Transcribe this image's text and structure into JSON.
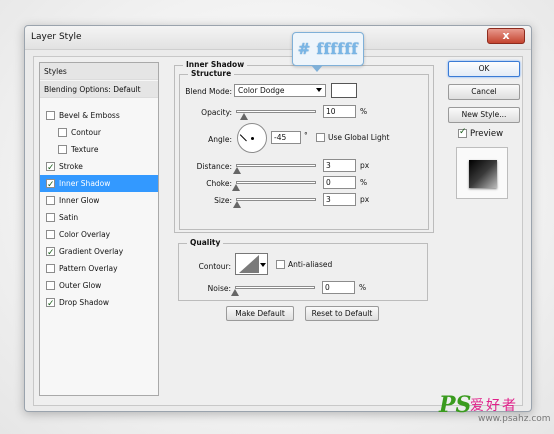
{
  "window": {
    "title": "Layer Style",
    "close_label": "x"
  },
  "styles_panel": {
    "header": "Styles",
    "blending_options": "Blending Options: Default",
    "items": [
      {
        "label": "Bevel & Emboss",
        "checked": false,
        "indent": false,
        "selected": false
      },
      {
        "label": "Contour",
        "checked": false,
        "indent": true,
        "selected": false
      },
      {
        "label": "Texture",
        "checked": false,
        "indent": true,
        "selected": false
      },
      {
        "label": "Stroke",
        "checked": true,
        "indent": false,
        "selected": false
      },
      {
        "label": "Inner Shadow",
        "checked": true,
        "indent": false,
        "selected": true
      },
      {
        "label": "Inner Glow",
        "checked": false,
        "indent": false,
        "selected": false
      },
      {
        "label": "Satin",
        "checked": false,
        "indent": false,
        "selected": false
      },
      {
        "label": "Color Overlay",
        "checked": false,
        "indent": false,
        "selected": false
      },
      {
        "label": "Gradient Overlay",
        "checked": true,
        "indent": false,
        "selected": false
      },
      {
        "label": "Pattern Overlay",
        "checked": false,
        "indent": false,
        "selected": false
      },
      {
        "label": "Outer Glow",
        "checked": false,
        "indent": false,
        "selected": false
      },
      {
        "label": "Drop Shadow",
        "checked": true,
        "indent": false,
        "selected": false
      }
    ]
  },
  "inner_shadow": {
    "section_title": "Inner Shadow",
    "structure_title": "Structure",
    "blend_mode_label": "Blend Mode:",
    "blend_mode_value": "Color Dodge",
    "color_swatch": "#ffffff",
    "opacity_label": "Opacity:",
    "opacity_value": "10",
    "opacity_unit": "%",
    "angle_label": "Angle:",
    "angle_value": "-45",
    "angle_unit": "°",
    "use_global_light_label": "Use Global Light",
    "use_global_light_checked": false,
    "distance_label": "Distance:",
    "distance_value": "3",
    "distance_unit": "px",
    "choke_label": "Choke:",
    "choke_value": "0",
    "choke_unit": "%",
    "size_label": "Size:",
    "size_value": "3",
    "size_unit": "px",
    "opacity_level": 0.1,
    "distance_level": 0.012,
    "choke_level": 0,
    "size_level": 0.012
  },
  "quality": {
    "title": "Quality",
    "contour_label": "Contour:",
    "anti_aliased_label": "Anti-aliased",
    "anti_aliased_checked": false,
    "noise_label": "Noise:",
    "noise_value": "0",
    "noise_unit": "%",
    "noise_level": 0
  },
  "buttons": {
    "make_default": "Make Default",
    "reset_default": "Reset to Default",
    "ok": "OK",
    "cancel": "Cancel",
    "new_style": "New Style...",
    "preview_label": "Preview",
    "preview_checked": true
  },
  "tooltip": {
    "text": "# ffffff"
  },
  "watermark": {
    "ps": "PS",
    "cn": "爱好者",
    "url": "www.psahz.com"
  }
}
